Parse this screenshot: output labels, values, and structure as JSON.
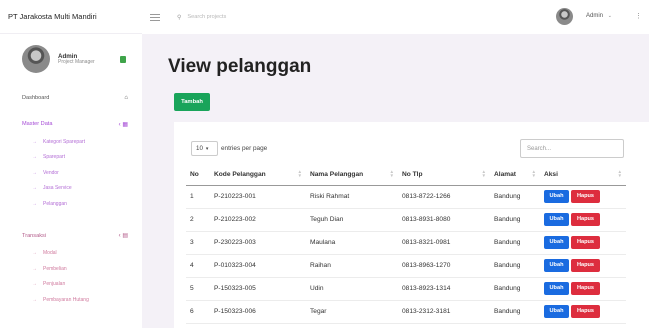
{
  "app": {
    "brand": "PT Jarakosta Multi Mandiri"
  },
  "sidebar": {
    "profile": {
      "name": "Admin",
      "role": "Project Manager"
    },
    "dashboard": "Dashboard",
    "master": {
      "label": "Master Data",
      "items": [
        "Kategori Sparepart",
        "Sparepart",
        "Vendor",
        "Jasa Service",
        "Pelanggan"
      ]
    },
    "transaksi": {
      "label": "Transaksi",
      "items": [
        "Modal",
        "Pembelian",
        "Penjualan",
        "Pembayaran Hutang"
      ]
    }
  },
  "topbar": {
    "search_placeholder": "Search projects",
    "user": "Admin"
  },
  "page": {
    "title": "View pelanggan",
    "add_label": "Tambah",
    "length_value": "10",
    "length_text": "entries per page",
    "search_placeholder": "Search..."
  },
  "table": {
    "columns": [
      "No",
      "Kode Pelanggan",
      "Nama Pelanggan",
      "No Tlp",
      "Alamat",
      "Aksi"
    ],
    "edit_label": "Ubah",
    "delete_label": "Hapus",
    "rows": [
      {
        "no": "1",
        "kode": "P-210223-001",
        "nama": "Riski Rahmat",
        "tlp": "0813-8722-1266",
        "alamat": "Bandung"
      },
      {
        "no": "2",
        "kode": "P-210223-002",
        "nama": "Teguh Dian",
        "tlp": "0813-8931-8080",
        "alamat": "Bandung"
      },
      {
        "no": "3",
        "kode": "P-230223-003",
        "nama": "Maulana",
        "tlp": "0813-8321-0981",
        "alamat": "Bandung"
      },
      {
        "no": "4",
        "kode": "P-010323-004",
        "nama": "Raihan",
        "tlp": "0813-8963-1270",
        "alamat": "Bandung"
      },
      {
        "no": "5",
        "kode": "P-150323-005",
        "nama": "Udin",
        "tlp": "0813-8923-1314",
        "alamat": "Bandung"
      },
      {
        "no": "6",
        "kode": "P-150323-006",
        "nama": "Tegar",
        "tlp": "0813-2312-3181",
        "alamat": "Bandung"
      }
    ]
  }
}
